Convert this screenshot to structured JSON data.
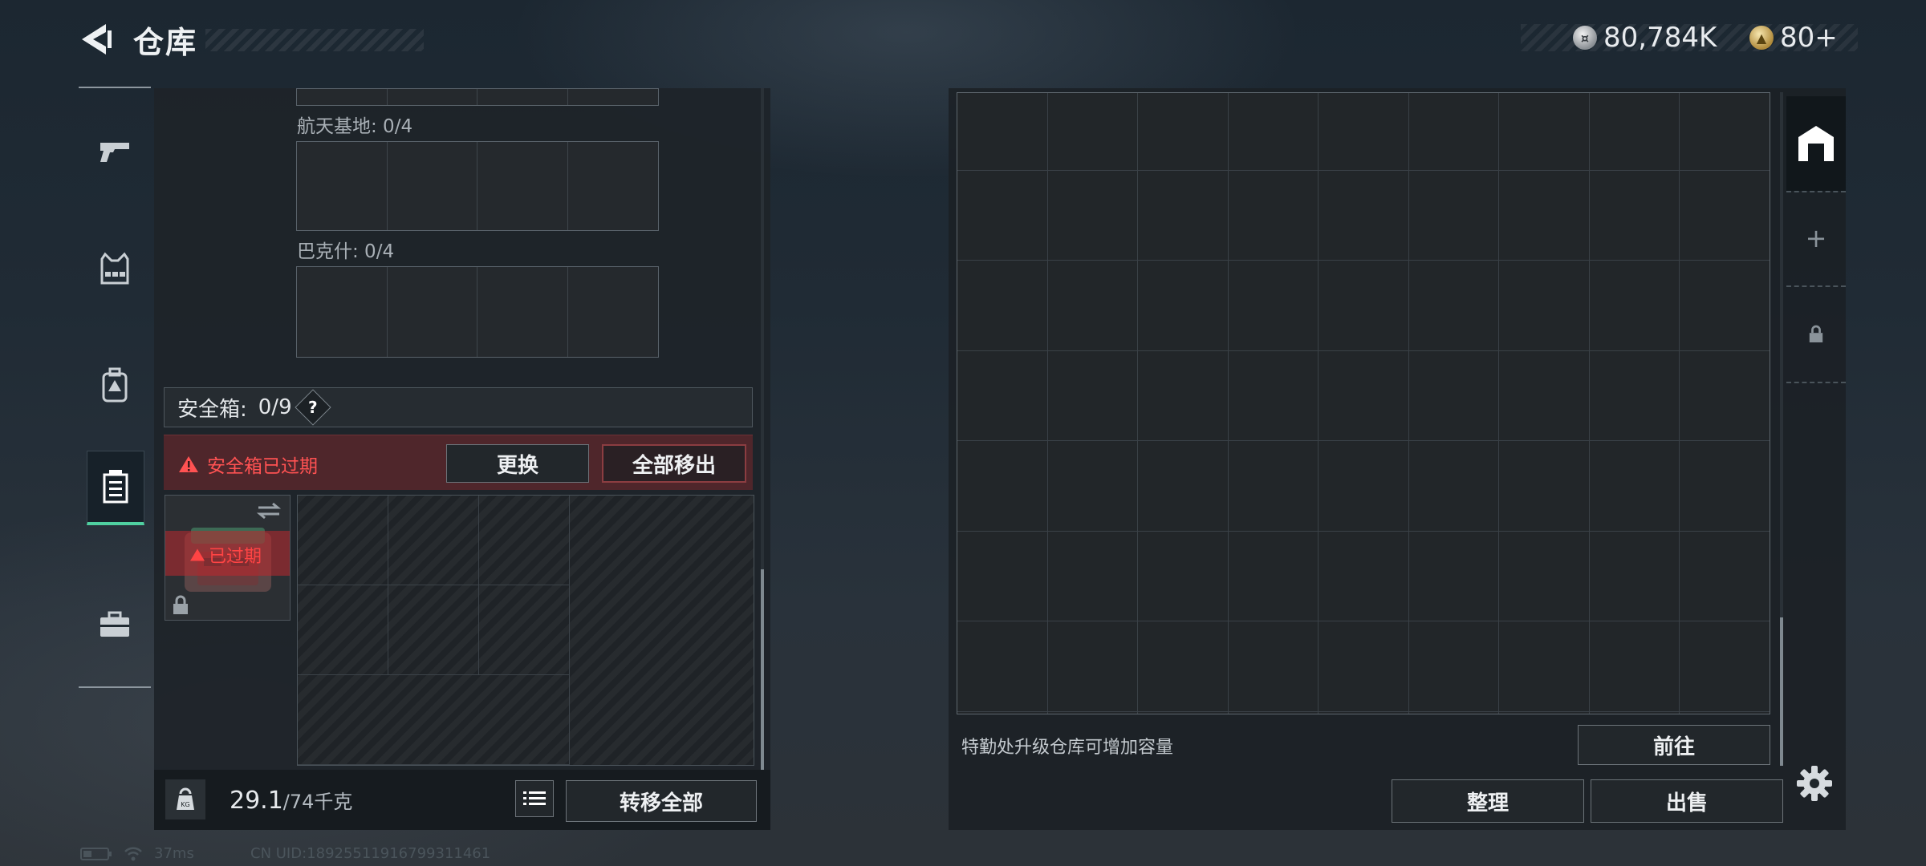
{
  "header": {
    "title": "仓库",
    "currencies": [
      {
        "icon": "silver-coin-icon",
        "value": "80,784K"
      },
      {
        "icon": "gold-coin-icon",
        "value": "80+"
      }
    ]
  },
  "left_nav": {
    "items": [
      {
        "icon": "pistol-icon"
      },
      {
        "icon": "vest-icon"
      },
      {
        "icon": "backpack-icon"
      },
      {
        "icon": "safe-box-icon",
        "active": true
      },
      {
        "icon": "briefcase-icon"
      }
    ]
  },
  "left_panel": {
    "sections": [
      {
        "label": "航天基地: 0/4"
      },
      {
        "label": "巴克什: 0/4"
      }
    ],
    "safe_box": {
      "label": "安全箱:",
      "count": "0/9",
      "help": "?",
      "alert": "安全箱已过期",
      "replace_label": "更换",
      "remove_all_label": "全部移出",
      "item_badge": "已过期"
    },
    "weight": {
      "current": "29.1",
      "max": "/74千克",
      "icon_text": "KG"
    },
    "transfer_all_label": "转移全部"
  },
  "right_panel": {
    "hint": "特勤处升级仓库可增加容量",
    "goto_label": "前往",
    "sort_label": "整理",
    "sell_label": "出售",
    "side_tabs": [
      {
        "icon": "warehouse-icon",
        "active": true
      },
      {
        "icon": "plus-icon"
      },
      {
        "icon": "lock-icon"
      }
    ]
  },
  "status_bar": {
    "ping": "37ms",
    "uid": "CN UID:18925511916799311461"
  },
  "colors": {
    "accent_green": "#4fd0a0",
    "alert_red": "#ff5252"
  }
}
